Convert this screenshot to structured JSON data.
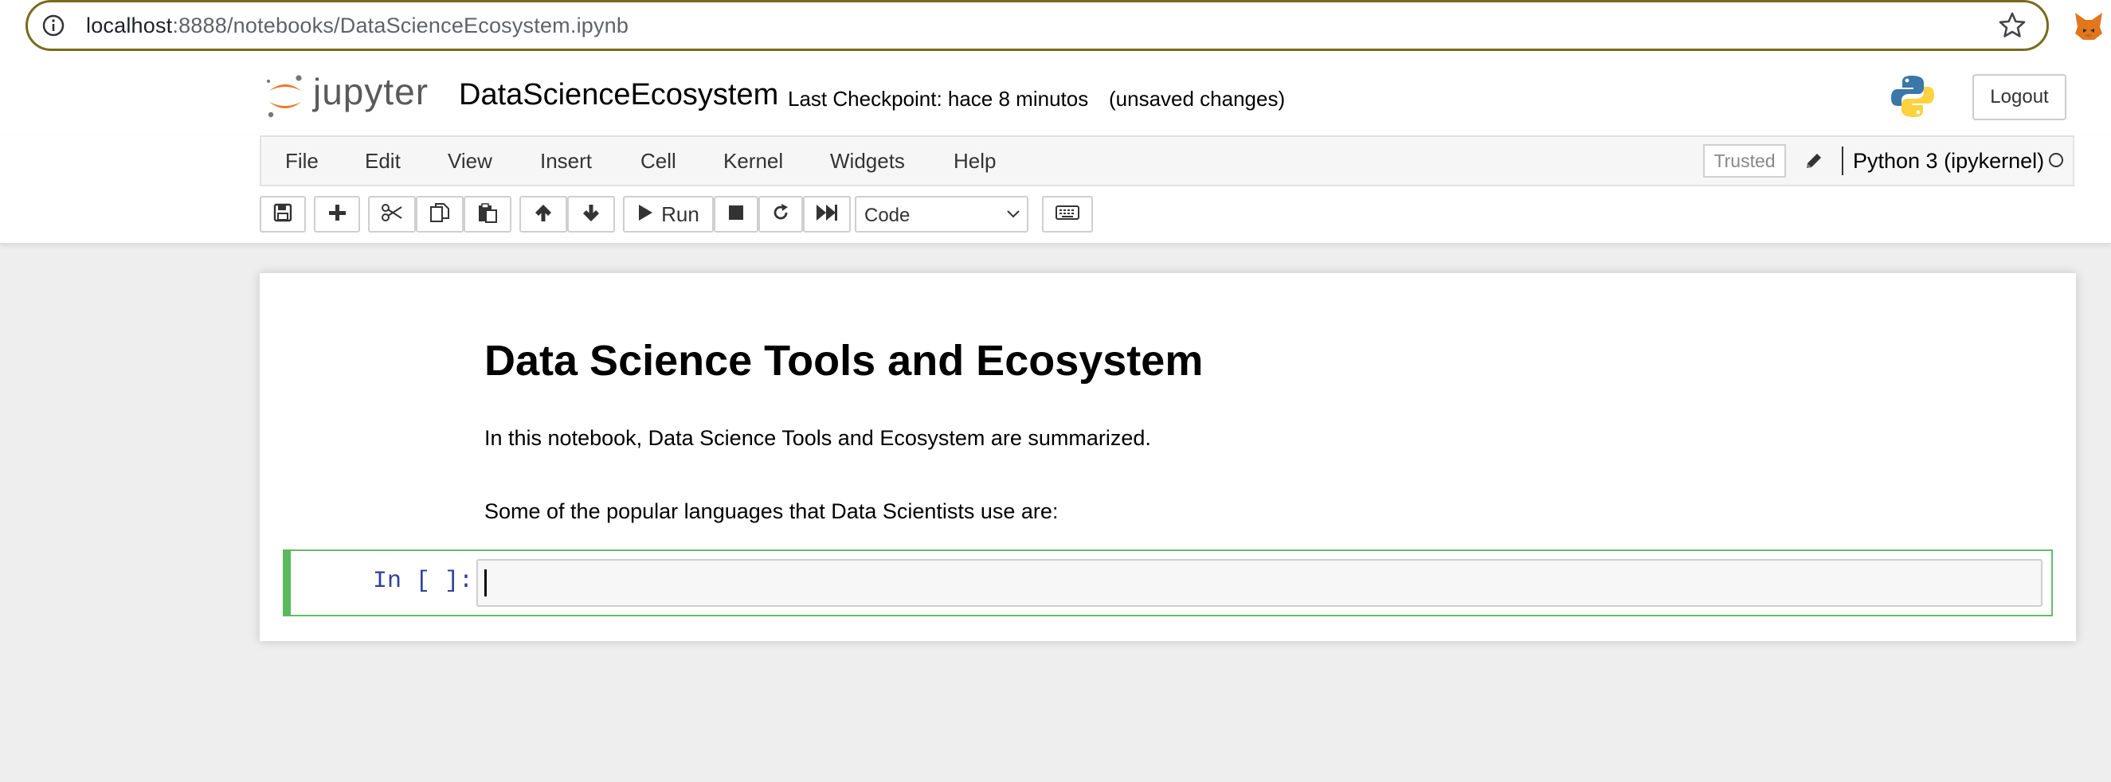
{
  "browser": {
    "url_host": "localhost",
    "url_path": ":8888/notebooks/DataScienceEcosystem.ipynb",
    "icons": [
      "info-icon",
      "star-icon",
      "extension-fox-icon"
    ]
  },
  "header": {
    "logo_text": "jupyter",
    "notebook_title": "DataScienceEcosystem",
    "checkpoint": "Last Checkpoint: hace 8 minutos",
    "autosave_status": "(unsaved changes)",
    "logout_label": "Logout"
  },
  "menubar": {
    "items": [
      "File",
      "Edit",
      "View",
      "Insert",
      "Cell",
      "Kernel",
      "Widgets",
      "Help"
    ],
    "trusted_label": "Trusted",
    "kernel_name": "Python 3 (ipykernel)"
  },
  "toolbar": {
    "run_label": "Run",
    "cell_type": "Code",
    "icons": [
      "save-icon",
      "plus-icon",
      "cut-icon",
      "copy-icon",
      "paste-icon",
      "arrow-up-icon",
      "arrow-down-icon",
      "run-icon",
      "stop-icon",
      "restart-icon",
      "fast-forward-icon",
      "keyboard-icon"
    ]
  },
  "notebook": {
    "heading": "Data Science Tools and Ecosystem",
    "paragraph1": "In this notebook, Data Science Tools and Ecosystem are summarized.",
    "paragraph2": "Some of the popular languages that Data Scientists use are:",
    "code_cell_prompt": "In [ ]:",
    "code_cell_value": ""
  },
  "colors": {
    "selected_cell_border": "#66bb6a",
    "prompt_color": "#303f9f",
    "jupyter_orange": "#f37726"
  }
}
